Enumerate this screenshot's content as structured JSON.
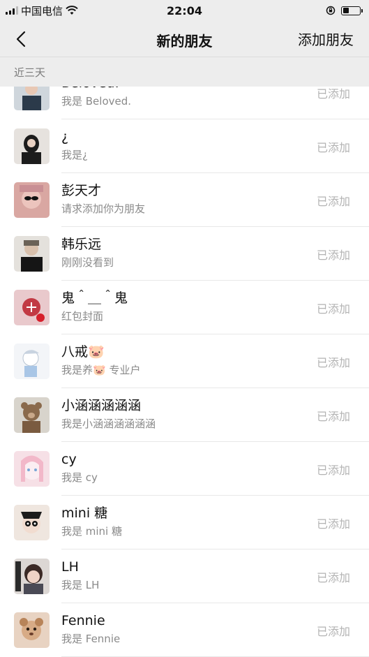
{
  "status_bar": {
    "carrier": "中国电信",
    "time": "22:04"
  },
  "nav": {
    "title": "新的朋友",
    "action": "添加朋友"
  },
  "section": {
    "label": "近三天"
  },
  "requests": [
    {
      "name": "Beloved.",
      "message": "我是 Beloved.",
      "status": "已添加"
    },
    {
      "name": "¿",
      "message": "我是¿",
      "status": "已添加"
    },
    {
      "name": "彭天才",
      "message": "请求添加你为朋友",
      "status": "已添加"
    },
    {
      "name": "韩乐远",
      "message": "刚刚没看到",
      "status": "已添加"
    },
    {
      "name": "鬼＾＿＾鬼",
      "message": "红包封面",
      "status": "已添加"
    },
    {
      "name": "八戒🐷",
      "message": "我是养🐷 专业户",
      "status": "已添加"
    },
    {
      "name": "小涵涵涵涵涵",
      "message": "我是小涵涵涵涵涵涵",
      "status": "已添加"
    },
    {
      "name": "cy",
      "message": "我是 cy",
      "status": "已添加"
    },
    {
      "name": "mini 糖",
      "message": "我是 mini 糖",
      "status": "已添加"
    },
    {
      "name": "LH",
      "message": "我是 LH",
      "status": "已添加"
    },
    {
      "name": "Fennie",
      "message": "我是 Fennie",
      "status": "已添加"
    }
  ]
}
